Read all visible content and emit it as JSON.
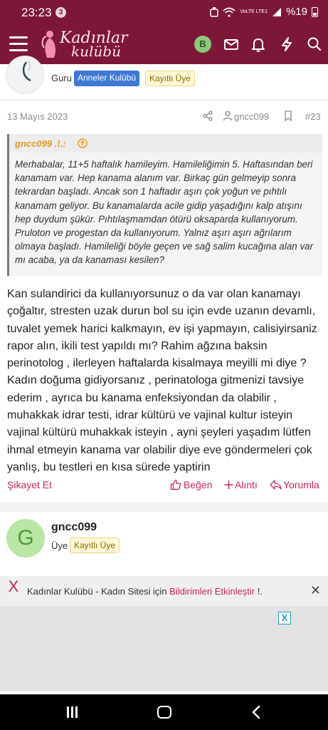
{
  "status_bar": {
    "time": "23:23",
    "notification_count": "3",
    "network": "VoLTE LTE1",
    "battery": "%19"
  },
  "header": {
    "logo_line1": "Kadınlar",
    "logo_line2": "kulübü",
    "user_initial": "B",
    "brand_color": "#7d1738"
  },
  "post": {
    "author_role": "Guru",
    "badge_club": "Anneler Kulübü",
    "badge_member": "Kayıtlı Üye",
    "date": "13 Mayıs 2023",
    "author": "gncc099",
    "post_number": "#23",
    "quote": {
      "name": "gncc099 .!.:",
      "text": "Merhabalar, 11+5 haftalık hamileyim. Hamileliğimin 5. Haftasından beri kanamam var. Hep kanama alanım var. Birkaç gün gelmeyip sonra tekrardan başladı. Ancak son 1 haftadır aşırı çok yoğun ve pıhtılı kanamam geliyor. Bu kanamalarda acile gidip yaşadığını kalp atışını hep duydum şükür. Pıhtılaşmamdan ötürü oksaparda kullanıyorum. Pruloton ve progestan da kullanıyorum. Yalnız aşırı aşırı ağrılarım olmaya başladı. Hamileliği böyle geçen ve sağ salim kucağına alan var mı acaba, ya da kanaması kesilen?"
    },
    "body": "Kan sulandirici da kullanıyorsunuz o da var olan kanamayı çoğaltır, stresten uzak durun bol su için evde uzanın devamlı, tuvalet yemek harici kalkmayın, ev işi yapmayın, calisiyirsaniz rapor alın, ikili test yapıldı mı? Rahim ağzına baksin perinotolog , ilerleyen haftalarda kisalmaya meyilli mi diye ? Kadın doğuma gidiyorsanız , perinatologa gitmenizi tavsiye ederim , ayrıca bu kanama enfeksiyondan da olabilir , muhakkak idrar testi, idrar kültürü ve vajinal kultur isteyin vajinal kültürü muhakkak isteyin , ayni şeyleri yaşadım lütfen ihmal etmeyin kanama var olabilir diye eve göndermeleri çok yanlış, bu testleri en kısa sürede yaptirin",
    "actions": {
      "report": "Şikayet Et",
      "like": "Beğen",
      "quote": "Alıntı",
      "reply": "Yorumla"
    }
  },
  "next_post": {
    "avatar_initial": "G",
    "username": "gncc099",
    "role": "Üye",
    "badge_member": "Kayıtlı Üye"
  },
  "banner": {
    "close_label": "X",
    "text_prefix": "Kadınlar Kulübü - Kadın Sitesi için ",
    "link_text": "Bildirimleri Etkinleştir",
    "text_suffix": " !.",
    "dismiss": "✕"
  },
  "ad": {
    "close_label": "X"
  }
}
